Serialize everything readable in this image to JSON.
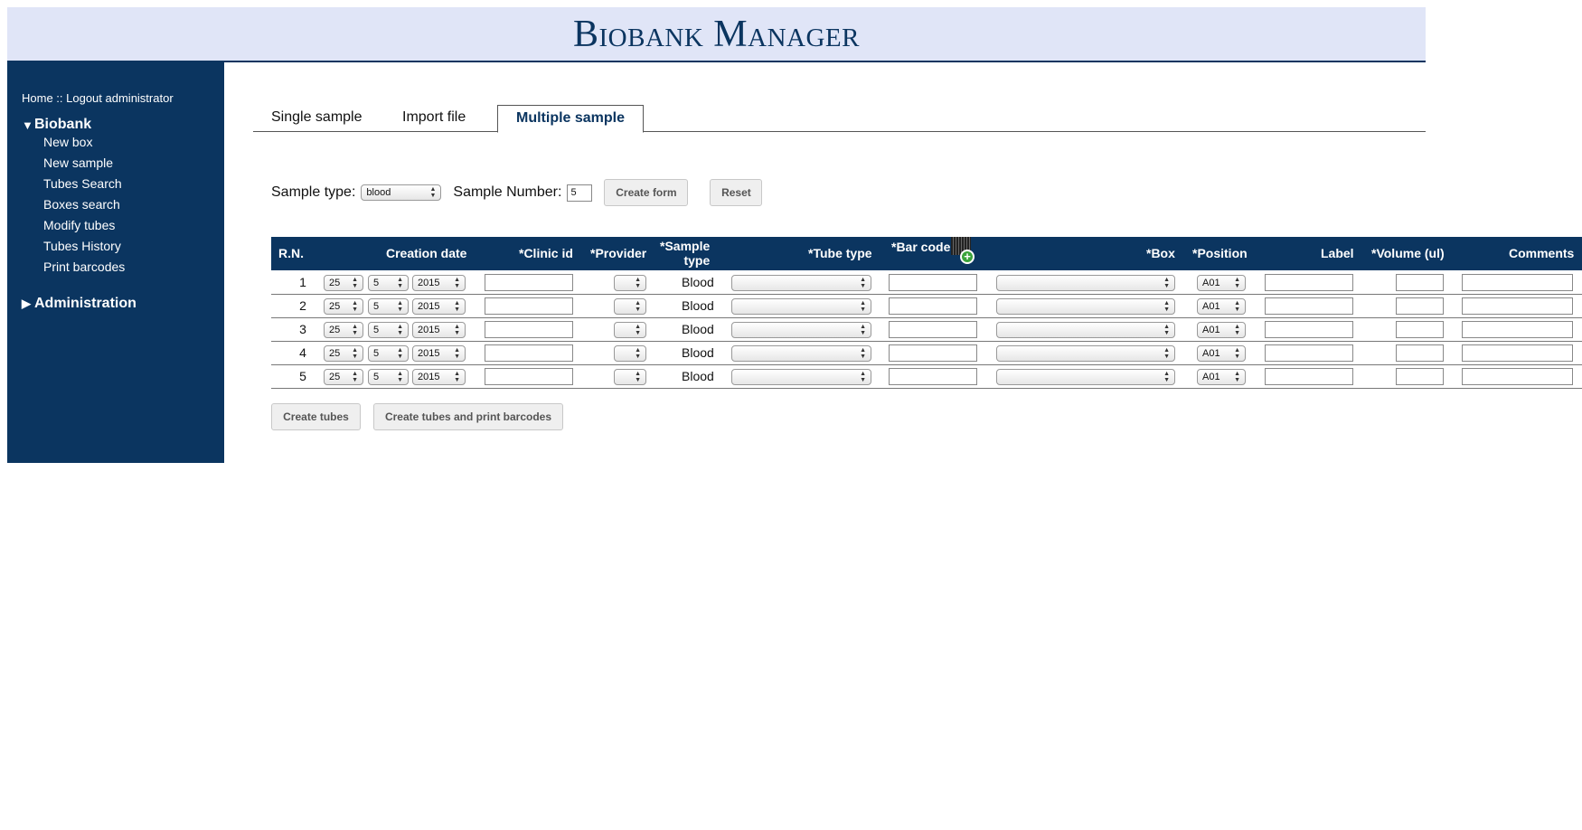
{
  "app": {
    "title": "Biobank Manager"
  },
  "sidebar": {
    "home": "Home",
    "sep": " :: ",
    "logout": "Logout administrator",
    "biobank_section": "Biobank",
    "items": [
      "New box",
      "New sample",
      "Tubes Search",
      "Boxes search",
      "Modify tubes",
      "Tubes History",
      "Print barcodes"
    ],
    "admin_section": "Administration"
  },
  "tabs": [
    {
      "label": "Single sample",
      "active": false
    },
    {
      "label": "Import file",
      "active": false
    },
    {
      "label": "Multiple sample",
      "active": true
    }
  ],
  "controls": {
    "sample_type_label": "Sample type:",
    "sample_type_value": "blood",
    "sample_number_label": "Sample Number:",
    "sample_number_value": "5",
    "create_form": "Create form",
    "reset": "Reset"
  },
  "table": {
    "headers": {
      "rn": "R.N.",
      "creation_date": "Creation date",
      "clinic_id": "*Clinic id",
      "provider": "*Provider",
      "sample_type_1": "*Sample",
      "sample_type_2": "type",
      "tube_type": "*Tube type",
      "bar_code": "*Bar code",
      "box": "*Box",
      "position": "*Position",
      "label": "Label",
      "volume": "*Volume (ul)",
      "comments": "Comments"
    },
    "rows": [
      {
        "rn": "1",
        "day": "25",
        "month": "5",
        "year": "2015",
        "sample_type": "Blood",
        "position": "A01"
      },
      {
        "rn": "2",
        "day": "25",
        "month": "5",
        "year": "2015",
        "sample_type": "Blood",
        "position": "A01"
      },
      {
        "rn": "3",
        "day": "25",
        "month": "5",
        "year": "2015",
        "sample_type": "Blood",
        "position": "A01"
      },
      {
        "rn": "4",
        "day": "25",
        "month": "5",
        "year": "2015",
        "sample_type": "Blood",
        "position": "A01"
      },
      {
        "rn": "5",
        "day": "25",
        "month": "5",
        "year": "2015",
        "sample_type": "Blood",
        "position": "A01"
      }
    ]
  },
  "actions": {
    "create_tubes": "Create tubes",
    "create_tubes_print": "Create tubes and print barcodes"
  },
  "colors": {
    "navy": "#0b3560",
    "header_bg": "#e0e5f7"
  },
  "icons": {
    "add_cursor": "plus-icon"
  }
}
